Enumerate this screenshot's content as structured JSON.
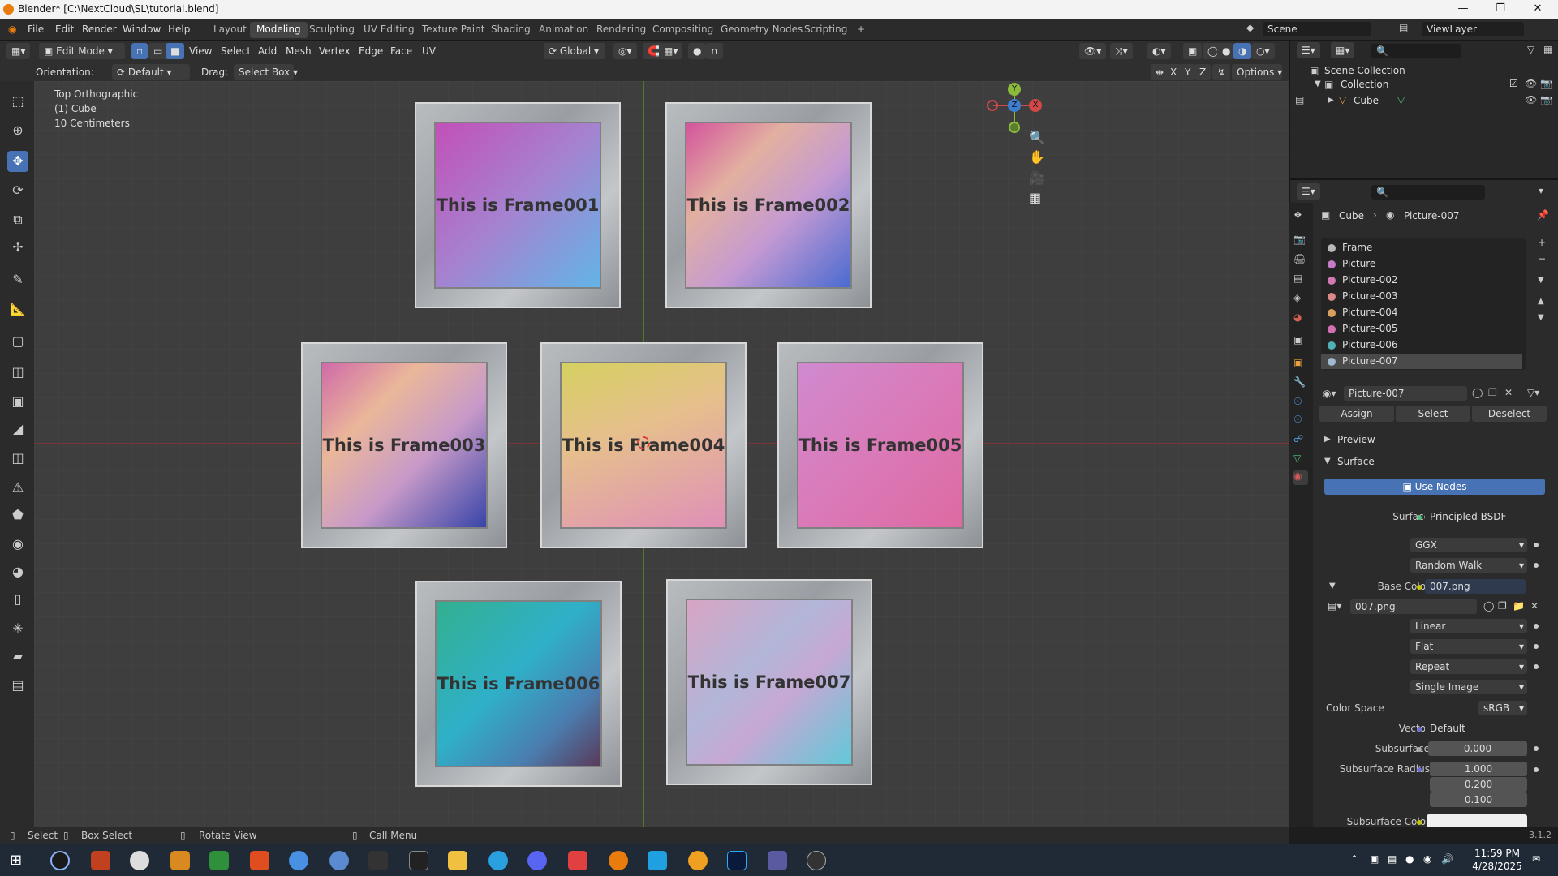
{
  "window": {
    "title": "Blender* [C:\\NextCloud\\SL\\tutorial.blend]"
  },
  "menu": [
    "File",
    "Edit",
    "Render",
    "Window",
    "Help"
  ],
  "workspaces": [
    "Layout",
    "Modeling",
    "Sculpting",
    "UV Editing",
    "Texture Paint",
    "Shading",
    "Animation",
    "Rendering",
    "Compositing",
    "Geometry Nodes",
    "Scripting"
  ],
  "active_workspace": "Modeling",
  "scene": "Scene",
  "view_layer": "ViewLayer",
  "header": {
    "mode": "Edit Mode",
    "menus": [
      "View",
      "Select",
      "Add",
      "Mesh",
      "Vertex",
      "Edge",
      "Face",
      "UV"
    ],
    "transform": "Global"
  },
  "tool_settings": {
    "orientation_label": "Orientation:",
    "orientation": "Default",
    "drag_label": "Drag:",
    "drag": "Select Box",
    "options": "Options",
    "axes": [
      "X",
      "Y",
      "Z"
    ]
  },
  "viewport": {
    "view": "Top Orthographic",
    "object": "(1) Cube",
    "scale": "10 Centimeters"
  },
  "gizmo": {
    "x": "X",
    "y": "Y",
    "z": "Z"
  },
  "frames": [
    {
      "line1": "This is Frame",
      "line2": "001"
    },
    {
      "line1": "This is Frame",
      "line2": "002"
    },
    {
      "line1": "This is Frame",
      "line2": "003"
    },
    {
      "line1": "This is Frame",
      "line2": "004"
    },
    {
      "line1": "This is Frame",
      "line2": "005"
    },
    {
      "line1": "This is Frame",
      "line2": "006"
    },
    {
      "line1": "This is Frame",
      "line2": "007"
    }
  ],
  "outliner": {
    "scene_collection": "Scene Collection",
    "collection": "Collection",
    "object": "Cube"
  },
  "properties": {
    "breadcrumb_object": "Cube",
    "breadcrumb_material": "Picture-007",
    "slots": [
      {
        "name": "Frame",
        "color": "#b8b8b8"
      },
      {
        "name": "Picture",
        "color": "#c77ac7"
      },
      {
        "name": "Picture-002",
        "color": "#d07ab0"
      },
      {
        "name": "Picture-003",
        "color": "#d88a8a"
      },
      {
        "name": "Picture-004",
        "color": "#d8a060"
      },
      {
        "name": "Picture-005",
        "color": "#d070b0"
      },
      {
        "name": "Picture-006",
        "color": "#50b0b8"
      },
      {
        "name": "Picture-007",
        "color": "#a0b8d0"
      }
    ],
    "material_name": "Picture-007",
    "assign": "Assign",
    "select": "Select",
    "deselect": "Deselect",
    "preview": "Preview",
    "surface_panel": "Surface",
    "use_nodes": "Use Nodes",
    "surface_label": "Surface",
    "surface_value": "Principled BSDF",
    "distribution": "GGX",
    "subsurface_method": "Random Walk",
    "base_color_label": "Base Color",
    "base_color_value": "007.png",
    "image_name": "007.png",
    "interpolation": "Linear",
    "projection": "Flat",
    "extension": "Repeat",
    "source": "Single Image",
    "color_space_label": "Color Space",
    "color_space": "sRGB",
    "vector_label": "Vector",
    "vector": "Default",
    "subsurface_label": "Subsurface",
    "subsurface": "0.000",
    "subsurface_radius_label": "Subsurface Radius",
    "radius": [
      "1.000",
      "0.200",
      "0.100"
    ],
    "subsurface_color_label": "Subsurface Color"
  },
  "status": {
    "select": "Select",
    "box_select": "Box Select",
    "rotate": "Rotate View",
    "call_menu": "Call Menu",
    "version": "3.1.2"
  },
  "clock": {
    "time": "11:59 PM",
    "date": "4/28/2025"
  }
}
